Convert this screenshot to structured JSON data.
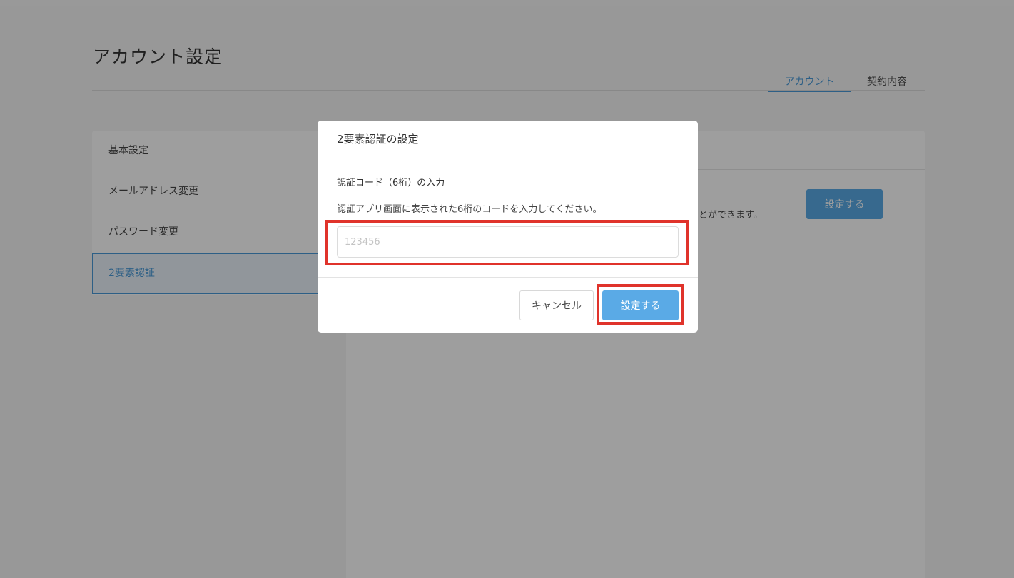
{
  "page": {
    "title": "アカウント設定",
    "tabs": [
      {
        "label": "アカウント",
        "active": true
      },
      {
        "label": "契約内容",
        "active": false
      }
    ]
  },
  "sidebar": {
    "items": [
      {
        "label": "基本設定",
        "active": false
      },
      {
        "label": "メールアドレス変更",
        "active": false
      },
      {
        "label": "パスワード変更",
        "active": false
      },
      {
        "label": "2要素認証",
        "active": true
      }
    ]
  },
  "content": {
    "description_tail": "とができます。",
    "button_label": "設定する"
  },
  "modal": {
    "title": "2要素認証の設定",
    "field_label": "認証コード（6桁）の入力",
    "help_text": "認証アプリ画面に表示された6桁のコードを入力してください。",
    "input": {
      "value": "",
      "placeholder": "123456"
    },
    "cancel_label": "キャンセル",
    "submit_label": "設定する"
  },
  "colors": {
    "accent": "#5aaae6",
    "highlight": "#e0332b"
  }
}
